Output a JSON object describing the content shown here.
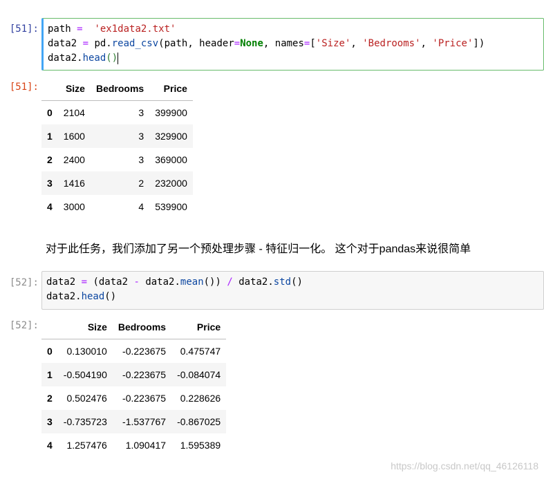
{
  "cells": [
    {
      "in_prompt": "[51]:",
      "out_prompt": "[51]:",
      "code": {
        "l1_a": "path ",
        "l1_eq": "=",
        "l1_b": "  ",
        "l1_str": "'ex1data2.txt'",
        "l2_var": "data2 ",
        "l2_eq": "=",
        "l2_pd": " pd.",
        "l2_fn": "read_csv",
        "l2_open": "(path, header",
        "l2_eq2": "=",
        "l2_none": "None",
        "l2_names": ", names",
        "l2_eq3": "=",
        "l2_lb": "[",
        "l2_s1": "'Size'",
        "l2_c1": ", ",
        "l2_s2": "'Bedrooms'",
        "l2_c2": ", ",
        "l2_s3": "'Price'",
        "l2_end": "])",
        "l3_var": "data2.",
        "l3_fn": "head",
        "l3_paren": "()"
      },
      "table": {
        "columns": [
          "Size",
          "Bedrooms",
          "Price"
        ],
        "rows": [
          {
            "index": "0",
            "values": [
              "2104",
              "3",
              "399900"
            ]
          },
          {
            "index": "1",
            "values": [
              "1600",
              "3",
              "329900"
            ]
          },
          {
            "index": "2",
            "values": [
              "2400",
              "3",
              "369000"
            ]
          },
          {
            "index": "3",
            "values": [
              "1416",
              "2",
              "232000"
            ]
          },
          {
            "index": "4",
            "values": [
              "3000",
              "4",
              "539900"
            ]
          }
        ]
      }
    },
    {
      "in_prompt": "[52]:",
      "out_prompt": "[52]:",
      "code": {
        "l1_var": "data2 ",
        "l1_eq": "=",
        "l1_a": " (data2 ",
        "l1_minus": "-",
        "l1_b": " data2.",
        "l1_mean": "mean",
        "l1_c": "()) ",
        "l1_div": "/",
        "l1_d": " data2.",
        "l1_std": "std",
        "l1_e": "()",
        "l2_var": "data2.",
        "l2_fn": "head",
        "l2_paren": "()"
      },
      "table": {
        "columns": [
          "Size",
          "Bedrooms",
          "Price"
        ],
        "rows": [
          {
            "index": "0",
            "values": [
              "0.130010",
              "-0.223675",
              "0.475747"
            ]
          },
          {
            "index": "1",
            "values": [
              "-0.504190",
              "-0.223675",
              "-0.084074"
            ]
          },
          {
            "index": "2",
            "values": [
              "0.502476",
              "-0.223675",
              "0.228626"
            ]
          },
          {
            "index": "3",
            "values": [
              "-0.735723",
              "-1.537767",
              "-0.867025"
            ]
          },
          {
            "index": "4",
            "values": [
              "1.257476",
              "1.090417",
              "1.595389"
            ]
          }
        ]
      }
    }
  ],
  "markdown_text": "对于此任务，我们添加了另一个预处理步骤 - 特征归一化。 这个对于pandas来说很简单",
  "watermark": "https://blog.csdn.net/qq_46126118"
}
